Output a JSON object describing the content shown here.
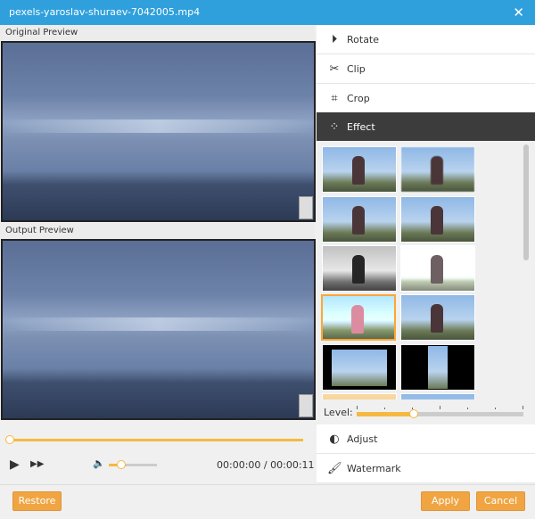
{
  "window": {
    "title": "pexels-yaroslav-shuraev-7042005.mp4",
    "close_icon": "close-icon"
  },
  "preview": {
    "original_label": "Original Preview",
    "output_label": "Output Preview"
  },
  "player": {
    "progress": 0,
    "volume_percent": 25,
    "time_current": "00:00:00",
    "time_total": "00:00:11",
    "separator": "/"
  },
  "menu": [
    {
      "label": "Rotate",
      "icon": "rotate-icon"
    },
    {
      "label": "Clip",
      "icon": "scissors-icon"
    },
    {
      "label": "Crop",
      "icon": "crop-icon"
    },
    {
      "label": "Effect",
      "icon": "effect-icon",
      "active": true
    },
    {
      "label": "Adjust",
      "icon": "adjust-icon"
    },
    {
      "label": "Watermark",
      "icon": "brush-icon"
    }
  ],
  "effects": {
    "selected_index": 6,
    "level_label": "Level:",
    "level_percent": 35
  },
  "buttons": {
    "restore": "Restore",
    "apply": "Apply",
    "cancel": "Cancel"
  },
  "colors": {
    "titlebar": "#2fa0dc",
    "accent": "#f0a542",
    "active_menu": "#3c3c3c"
  }
}
